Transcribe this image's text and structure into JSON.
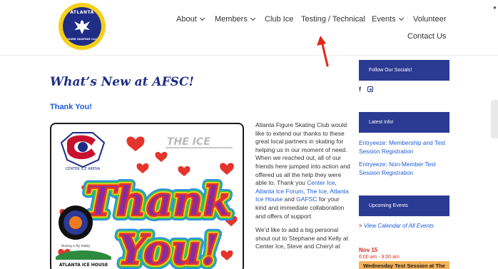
{
  "site": {
    "logo_alt": "Atlanta Figure Skating Club logo",
    "logo_text_top": "ATLANTA",
    "logo_text_bottom": "FIGURE SKATING CLUB"
  },
  "nav": {
    "items": [
      {
        "label": "About",
        "has_dropdown": true
      },
      {
        "label": "Members",
        "has_dropdown": true
      },
      {
        "label": "Club Ice",
        "has_dropdown": false
      },
      {
        "label": "Testing / Technical",
        "has_dropdown": false
      },
      {
        "label": "Events",
        "has_dropdown": true
      },
      {
        "label": "Volunteer",
        "has_dropdown": false
      },
      {
        "label": "Contact Us",
        "has_dropdown": false
      }
    ]
  },
  "page": {
    "title": "What’s New at AFSC!",
    "subtitle": "Thank You!"
  },
  "image": {
    "sponsor_top_left": "CENTER ICE ARENA",
    "sponsor_top_right": "THE ICE",
    "thank_line1": "Thank",
    "thank_line2": "You!",
    "sponsor_left_mid": "GEORGIA FIGURE SKATING CLUB",
    "sponsor_left_mid_caption": "Skating is My Hobby",
    "sponsor_bottom": "ATLANTA ICE HOUSE"
  },
  "article": {
    "p1_a": "Atlanta Figure Skating Club would like to extend our thanks to these great local partners in skating for helping us in our moment of need. When we reached out, all of our friends here jumped into action and offered us all the help they were able to. Thank you ",
    "link_center_ice": "Center Ice",
    "sep1": ", ",
    "link_ice_forum": "Atlanta Ice Forum",
    "sep2": ", ",
    "link_the_ice": "The Ice",
    "sep3": ", ",
    "link_ice_house": "Atlanta Ice House",
    "sep4": " and ",
    "link_gafsc": "GAFSC",
    "p1_b": " for your kind and immediate collaboration and offers of support.",
    "p2": "We’d like to add a big personal shout out to Stephane and Kelly at Center Ice, Steve and Cheryl at"
  },
  "sidebar": {
    "follow_heading": "Follow Our Socials!",
    "social_facebook": "f",
    "latest_heading": "Latest Info!",
    "latest_links": [
      "Entryeeze: Membership and Test Session Registration",
      "Entryeeze: Non-Member Test Session Registration"
    ],
    "upcoming_heading": "Upcoming Events",
    "calendar_link_prefix": ">",
    "calendar_link": "View Calendar of All Events",
    "event_date": "Nov 15",
    "event_time": "6:00 am - 9:00 am",
    "event_title": "Wednesday Test Session at The"
  },
  "colors": {
    "brand_navy": "#1f2d86",
    "link_blue": "#1c5bd6",
    "sidebar_header": "#2b3a93",
    "event_red": "#d62b1f",
    "event_highlight": "#f5b35c",
    "annotation_arrow": "#e0291c"
  }
}
